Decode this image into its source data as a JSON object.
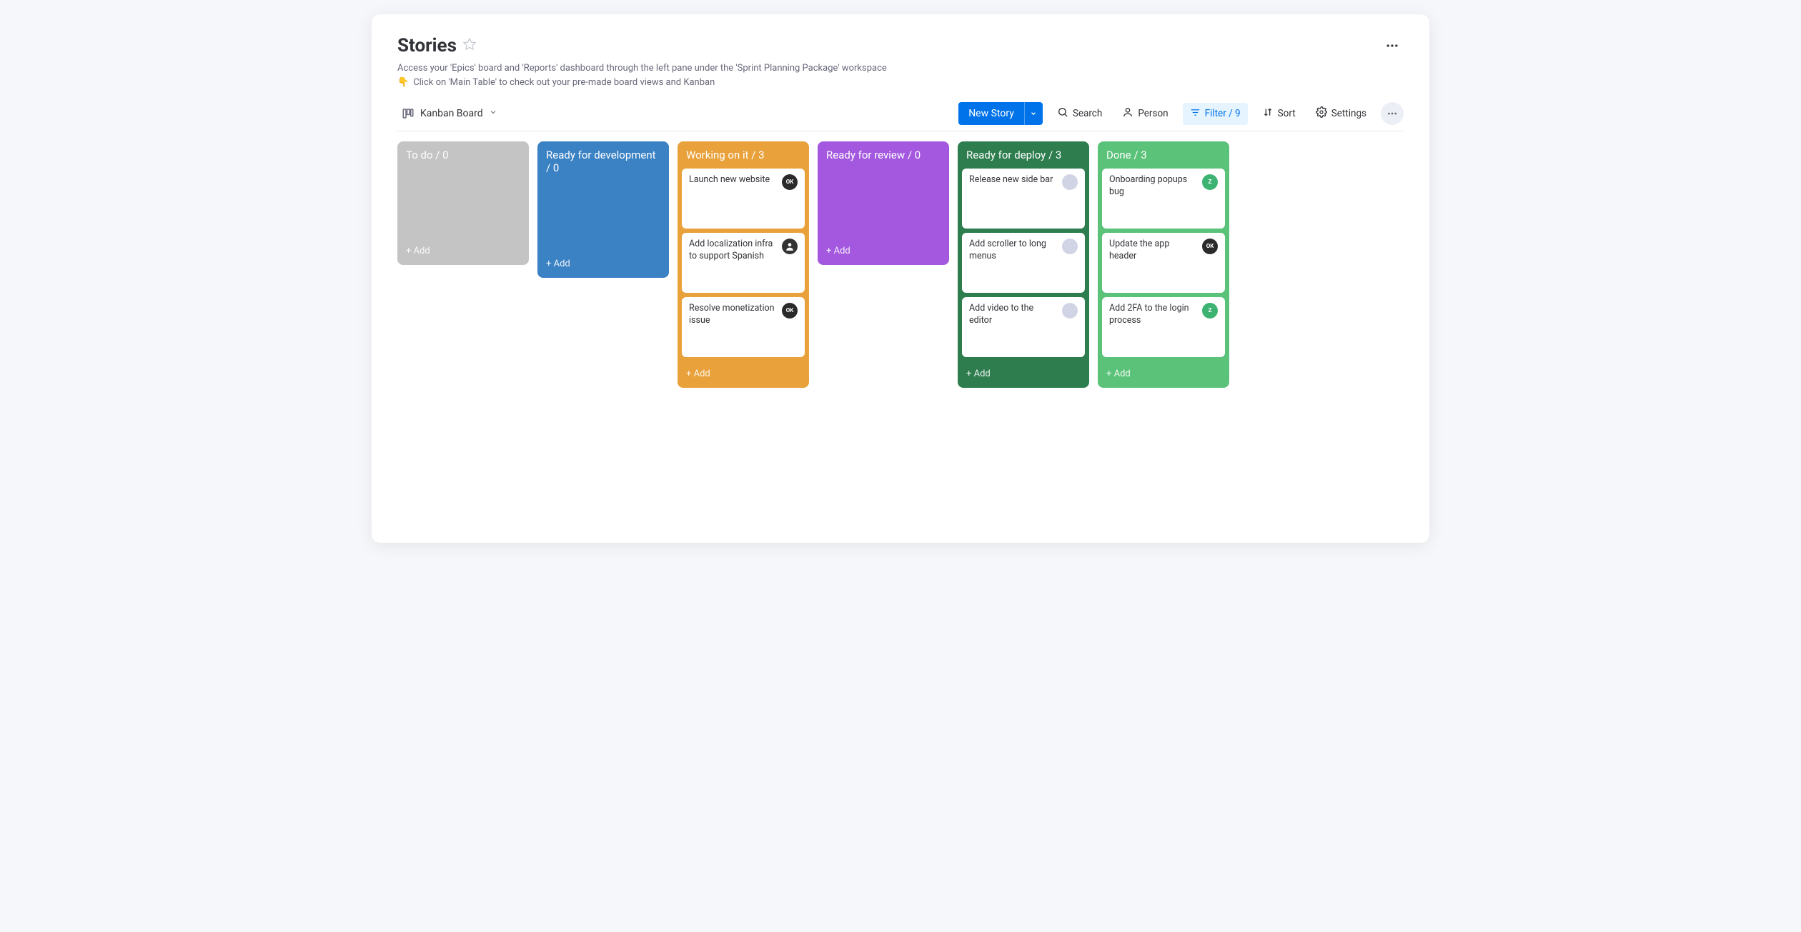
{
  "header": {
    "title": "Stories",
    "description": "Access your 'Epics' board and 'Reports' dashboard through the left pane under the 'Sprint Planning Package' workspace",
    "hint_emoji": "👇",
    "hint_text": "Click on 'Main Table' to check out your pre-made board views and Kanban"
  },
  "view": {
    "name": "Kanban Board"
  },
  "toolbar": {
    "new_story": "New Story",
    "search": "Search",
    "person": "Person",
    "filter_label": "Filter / 9",
    "sort": "Sort",
    "settings": "Settings"
  },
  "columns": [
    {
      "id": "todo",
      "color": "col-gray",
      "title": "To do / 0",
      "cards": [],
      "add_label": "+ Add"
    },
    {
      "id": "ready-dev",
      "color": "col-blue",
      "title": "Ready for development / 0",
      "cards": [],
      "add_label": "+ Add"
    },
    {
      "id": "working",
      "color": "col-orange",
      "title": "Working on it / 3",
      "cards": [
        {
          "title": "Launch new website",
          "avatar": "ok",
          "avatar_text": "OK"
        },
        {
          "title": "Add localization infra to support Spanish",
          "avatar": "person",
          "avatar_text": ""
        },
        {
          "title": "Resolve monetization issue",
          "avatar": "ok",
          "avatar_text": "OK"
        }
      ],
      "add_label": "+ Add"
    },
    {
      "id": "ready-review",
      "color": "col-purple",
      "title": "Ready for review / 0",
      "cards": [],
      "add_label": "+ Add"
    },
    {
      "id": "ready-deploy",
      "color": "col-darkgreen",
      "title": "Ready for deploy / 3",
      "cards": [
        {
          "title": "Release new side bar",
          "avatar": "gray",
          "avatar_text": ""
        },
        {
          "title": "Add scroller to long menus",
          "avatar": "gray",
          "avatar_text": ""
        },
        {
          "title": "Add video to the editor",
          "avatar": "gray",
          "avatar_text": ""
        }
      ],
      "add_label": "+ Add"
    },
    {
      "id": "done",
      "color": "col-green",
      "title": "Done / 3",
      "cards": [
        {
          "title": "Onboarding popups bug",
          "avatar": "z",
          "avatar_text": "Z"
        },
        {
          "title": "Update the app header",
          "avatar": "ok",
          "avatar_text": "OK"
        },
        {
          "title": "Add 2FA to the login process",
          "avatar": "z",
          "avatar_text": "Z"
        }
      ],
      "add_label": "+ Add"
    }
  ]
}
